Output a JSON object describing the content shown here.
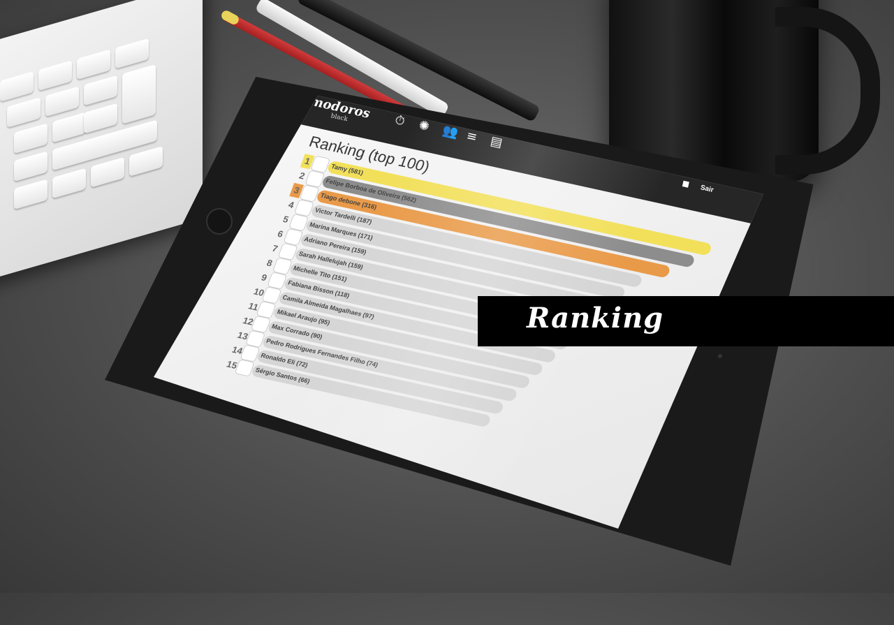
{
  "app": {
    "brand": "pomodoros",
    "brand_sub": "black",
    "nav_icons": [
      "timer-icon",
      "loading-icon",
      "users-icon",
      "list-icon",
      "calendar-icon"
    ],
    "chat_icon": "chat-icon",
    "logout_label": "Sair"
  },
  "ranking": {
    "title": "Ranking (top 100)",
    "rows": [
      {
        "rank": "1",
        "name": "Tamy (581)",
        "color": "#f2e05a",
        "bar": 1.0
      },
      {
        "rank": "2",
        "name": "Felipe Borboa de Oliveira (562)",
        "color": "#8d8d8d",
        "bar": 0.97
      },
      {
        "rank": "3",
        "name": "Tiago debone (316)",
        "color": "#e99a48",
        "bar": 0.92
      },
      {
        "rank": "4",
        "name": "Victor Tardelli (187)",
        "color": "#d5d5d5",
        "bar": 0.86
      },
      {
        "rank": "5",
        "name": "Marina Marques (171)",
        "color": "#d5d5d5",
        "bar": 0.83
      },
      {
        "rank": "6",
        "name": "Adriano Pereira (159)",
        "color": "#d5d5d5",
        "bar": 0.81
      },
      {
        "rank": "7",
        "name": "Sarah Hallelujah (159)",
        "color": "#d5d5d5",
        "bar": 0.79
      },
      {
        "rank": "8",
        "name": "Michelle Tito (151)",
        "color": "#d5d5d5",
        "bar": 0.77
      },
      {
        "rank": "9",
        "name": "Fabiana Bisson (118)",
        "color": "#d5d5d5",
        "bar": 0.74
      },
      {
        "rank": "10",
        "name": "Camila Almeida Magalhaes (97)",
        "color": "#d5d5d5",
        "bar": 0.72
      },
      {
        "rank": "11",
        "name": "Mikael Araujo (95)",
        "color": "#d5d5d5",
        "bar": 0.7
      },
      {
        "rank": "12",
        "name": "Max Corrado (90)",
        "color": "#d5d5d5",
        "bar": 0.68
      },
      {
        "rank": "13",
        "name": "Pedro Rodrigues Fernandes Filho (74)",
        "color": "#d5d5d5",
        "bar": 0.66
      },
      {
        "rank": "14",
        "name": "Ronaldo Eli (72)",
        "color": "#d5d5d5",
        "bar": 0.64
      },
      {
        "rank": "15",
        "name": "Sérgio Santos (66)",
        "color": "#d5d5d5",
        "bar": 0.62
      }
    ]
  },
  "caption": "Ranking"
}
